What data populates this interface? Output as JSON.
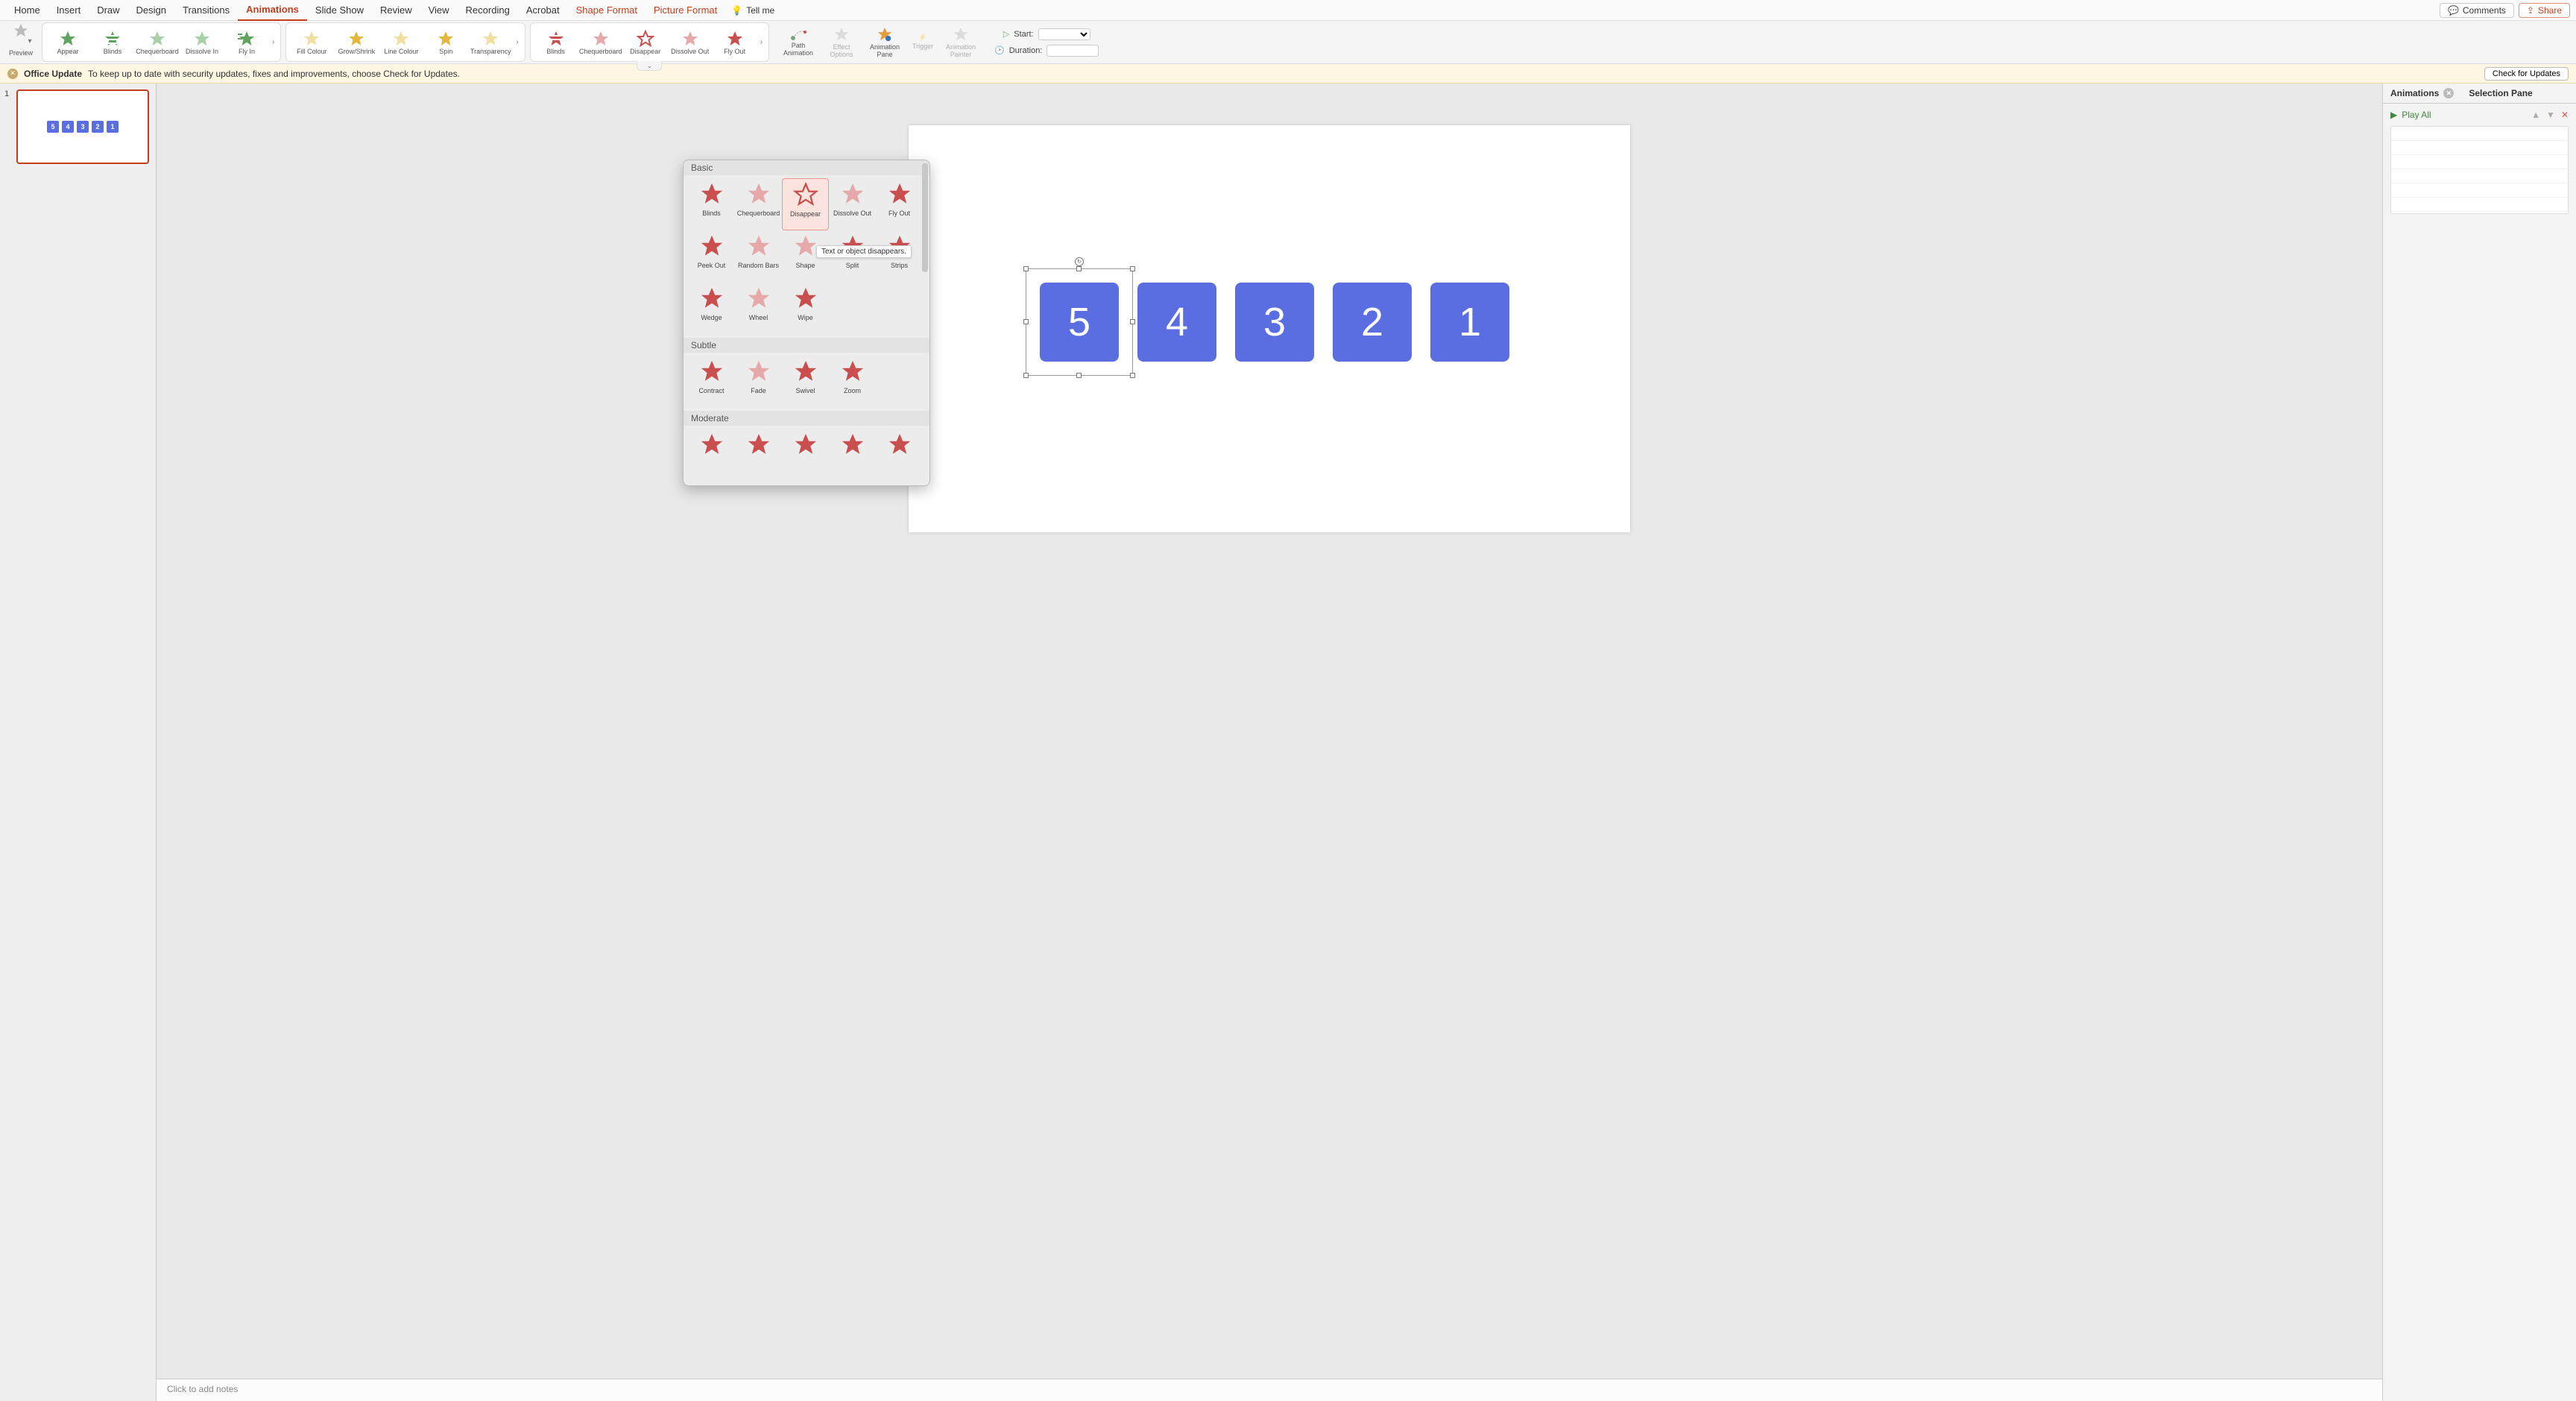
{
  "tabs": {
    "items": [
      "Home",
      "Insert",
      "Draw",
      "Design",
      "Transitions",
      "Animations",
      "Slide Show",
      "Review",
      "View",
      "Recording",
      "Acrobat",
      "Shape Format",
      "Picture Format"
    ],
    "active": "Animations",
    "contextual": [
      "Shape Format",
      "Picture Format"
    ],
    "tell_me": "Tell me",
    "comments": "Comments",
    "share": "Share"
  },
  "ribbon": {
    "preview": "Preview",
    "entrance": [
      "Appear",
      "Blinds",
      "Chequerboard",
      "Dissolve In",
      "Fly In"
    ],
    "emphasis": [
      "Fill Colour",
      "Grow/Shrink",
      "Line Colour",
      "Spin",
      "Transparency"
    ],
    "exit": [
      "Blinds",
      "Chequerboard",
      "Disappear",
      "Dissolve Out",
      "Fly Out"
    ],
    "path_animation": "Path\nAnimation",
    "effect_options": "Effect\nOptions",
    "animation_pane": "Animation\nPane",
    "trigger": "Trigger",
    "animation_painter": "Animation\nPainter",
    "start_label": "Start:",
    "start_value": "",
    "duration_label": "Duration:",
    "duration_value": ""
  },
  "update_bar": {
    "title": "Office Update",
    "msg": "To keep up to date with security updates, fixes and improvements, choose Check for Updates.",
    "button": "Check for Updates"
  },
  "thumbnail": {
    "index": "1",
    "minis": [
      "5",
      "4",
      "3",
      "2",
      "1"
    ]
  },
  "slide": {
    "boxes": [
      "5",
      "4",
      "3",
      "2",
      "1"
    ]
  },
  "notes_placeholder": "Click to add notes",
  "side_pane": {
    "tab_anim": "Animations",
    "tab_sel": "Selection Pane",
    "play_all": "Play All"
  },
  "popover": {
    "sections": {
      "basic_h": "Basic",
      "basic": [
        "Blinds",
        "Chequerboard",
        "Disappear",
        "Dissolve Out",
        "Fly Out",
        "Peek Out",
        "Random Bars",
        "Shape",
        "Split",
        "Strips",
        "Wedge",
        "Wheel",
        "Wipe"
      ],
      "subtle_h": "Subtle",
      "subtle": [
        "Contract",
        "Fade",
        "Swivel",
        "Zoom"
      ],
      "moderate_h": "Moderate",
      "moderate": [
        "",
        "",
        "",
        "",
        ""
      ]
    },
    "selected": "Disappear",
    "tooltip": "Text or object disappears."
  }
}
